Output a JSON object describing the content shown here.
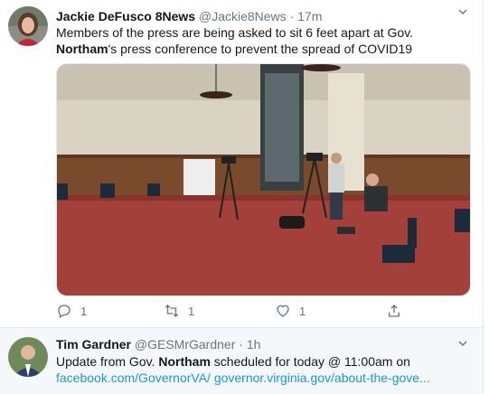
{
  "tweets": [
    {
      "name": "Jackie DeFusco 8News",
      "handle": "@Jackie8News",
      "separator": "·",
      "time": "17m",
      "text_pre": "Members of the press are being asked to sit 6 feet apart at Gov. ",
      "text_bold": "Northam",
      "text_post": "'s press conference to prevent the spread of COVID19",
      "actions": {
        "replies": "1",
        "retweets": "1",
        "likes": "1"
      }
    },
    {
      "name": "Tim Gardner",
      "handle": "@GESMrGardner",
      "separator": "·",
      "time": "1h",
      "text_pre": "Update from Gov. ",
      "text_bold": "Northam",
      "text_post": " scheduled for today @ 11:00am on",
      "link1": "facebook.com/GovernorVA/",
      "link2": "governor.virginia.gov/about-the-gove..."
    }
  ],
  "icons": [
    "reply-icon",
    "retweet-icon",
    "like-icon",
    "share-icon",
    "chevron-down-icon"
  ],
  "colors": {
    "link": "#1b95e0",
    "muted": "#657786",
    "text": "#14171a",
    "reply_bg": "#f5f8fa"
  }
}
